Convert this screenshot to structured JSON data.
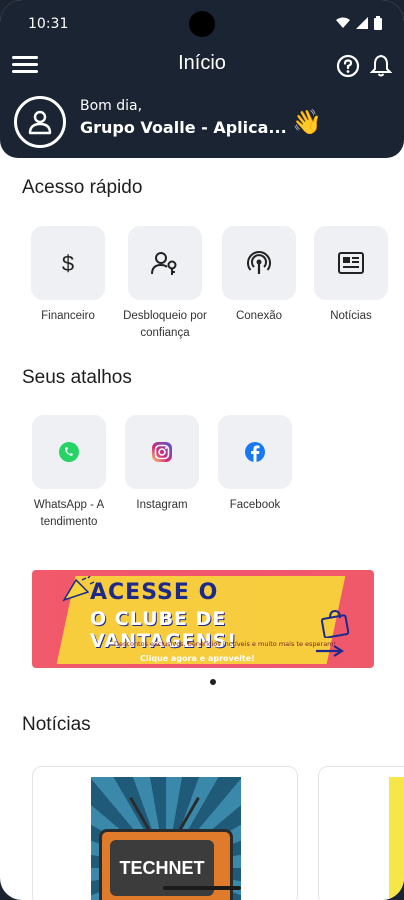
{
  "status_bar": {
    "time": "10:31"
  },
  "header": {
    "title": "Início",
    "greeting": "Bom dia,",
    "user_name": "Grupo Voalle - Aplica...",
    "wave_emoji": "👋",
    "icons": {
      "menu": "hamburger-menu-icon",
      "help": "help-circle-icon",
      "notifications": "bell-icon"
    }
  },
  "quick_access": {
    "title": "Acesso rápido",
    "items": [
      {
        "label": "Financeiro",
        "icon": "dollar-icon"
      },
      {
        "label": "Desbloqueio por confiança",
        "icon": "user-key-icon"
      },
      {
        "label": "Conexão",
        "icon": "wifi-signal-icon"
      },
      {
        "label": "Notícias",
        "icon": "newspaper-icon"
      }
    ]
  },
  "shortcuts": {
    "title": "Seus atalhos",
    "items": [
      {
        "label": "WhatsApp - Atendimento",
        "icon": "whatsapp-icon"
      },
      {
        "label": "Instagram",
        "icon": "instagram-icon"
      },
      {
        "label": "Facebook",
        "icon": "facebook-icon"
      }
    ]
  },
  "banner": {
    "line1": "ACESSE O",
    "line2": "O CLUBE DE VANTAGENS!",
    "subtitle": "Descontos exclusivos, benefícios incríveis e muito mais te esperam!",
    "cta": "Clique agora e aproveite!"
  },
  "news": {
    "title": "Notícias",
    "cards": [
      {
        "image_text": "TECHNET"
      }
    ]
  },
  "colors": {
    "header_bg": "#1b2433",
    "tile_bg": "#eef0f4",
    "banner_pink": "#f0546e",
    "banner_yellow": "#f7d43c"
  }
}
